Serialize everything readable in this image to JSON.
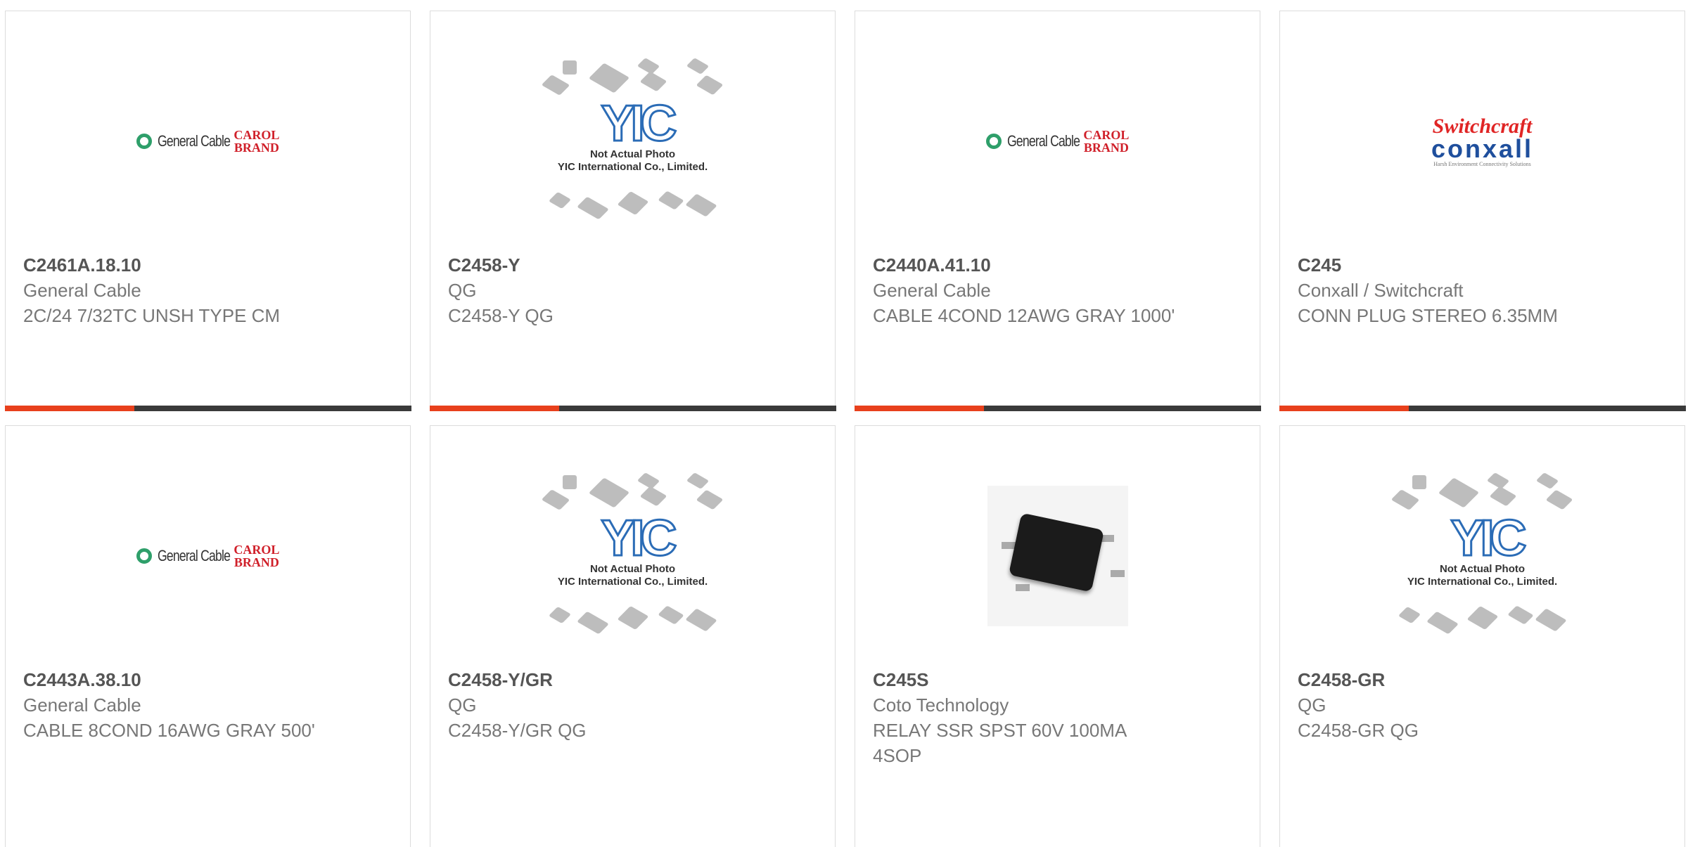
{
  "products": [
    {
      "pn": "C2461A.18.10",
      "mfr": "General Cable",
      "desc": "2C/24 7/32TC UNSH TYPE CM",
      "image": "general-cable-logo"
    },
    {
      "pn": "C2458-Y",
      "mfr": "QG",
      "desc": "C2458-Y QG",
      "image": "yic-placeholder"
    },
    {
      "pn": "C2440A.41.10",
      "mfr": "General Cable",
      "desc": "CABLE 4COND 12AWG GRAY 1000'",
      "image": "general-cable-logo"
    },
    {
      "pn": "C245",
      "mfr": "Conxall / Switchcraft",
      "desc": "CONN PLUG STEREO 6.35MM",
      "image": "switchcraft-conxall-logo"
    },
    {
      "pn": "C2443A.38.10",
      "mfr": "General Cable",
      "desc": "CABLE 8COND 16AWG GRAY 500'",
      "image": "general-cable-logo"
    },
    {
      "pn": "C2458-Y/GR",
      "mfr": "QG",
      "desc": "C2458-Y/GR QG",
      "image": "yic-placeholder"
    },
    {
      "pn": "C245S",
      "mfr": "Coto Technology",
      "desc": "RELAY SSR SPST 60V 100MA 4SOP",
      "image": "relay-photo"
    },
    {
      "pn": "C2458-GR",
      "mfr": "QG",
      "desc": "C2458-GR QG",
      "image": "yic-placeholder"
    }
  ],
  "logos": {
    "general_cable": "General Cable",
    "carol_line1": "CAROL",
    "carol_line2": "BRAND",
    "yic_letters": "YIC",
    "yic_note_line1": "Not Actual Photo",
    "yic_note_line2": "YIC International Co., Limited.",
    "switchcraft": "Switchcraft",
    "conxall": "conxall",
    "conxall_tagline": "Harsh Environment Connectivity Solutions"
  },
  "colors": {
    "accent": "#e8401c",
    "bar": "#3a3a3a",
    "text": "#777777",
    "pn": "#555555"
  }
}
